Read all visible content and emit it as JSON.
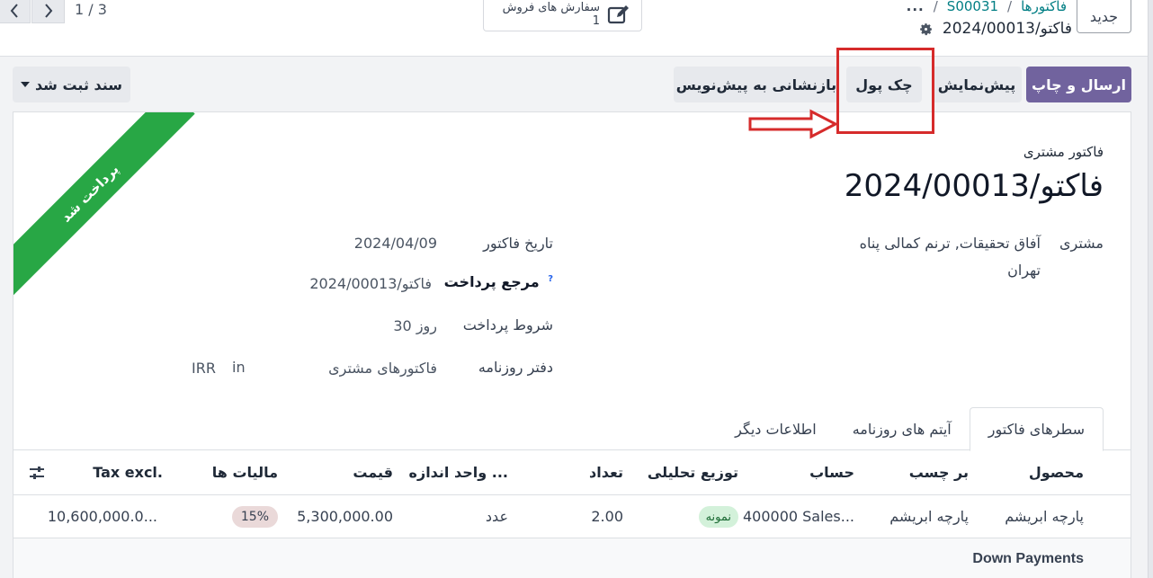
{
  "control_panel": {
    "new_button": "جدید",
    "breadcrumb": {
      "more": "...",
      "sales_order": "S00031",
      "invoices": "فاکتورها",
      "separator": "/"
    },
    "record_name": "فاکتو/2024/00013",
    "smart_button": {
      "label": "سفارش های فروش",
      "count": "1"
    },
    "pager": {
      "value": "1 / 3"
    }
  },
  "actions": {
    "send_print": "ارسال و چاپ",
    "preview": "پیش‌نمایش",
    "check": "چک پول",
    "reset_to_draft": "بازنشانی به پیش‌نویس",
    "status": "سند ثبت شد"
  },
  "ribbon": "پرداخت شد",
  "invoice": {
    "type_label": "فاکتور مشتری",
    "name": "فاکتو/2024/00013",
    "customer_label": "مشتری",
    "customer_name": "آفاق تحقیقات, ترنم کمالی پناه",
    "customer_city": "تهران",
    "date_label": "تاریخ فاکتور",
    "date_value": "2024/04/09",
    "payment_ref_label": "مرجع پرداخت",
    "payment_ref_help": "?",
    "payment_ref_value": "فاکتو/2024/00013",
    "payment_terms_label": "شروط پرداخت",
    "payment_terms_value": "30 روز",
    "journal_label": "دفتر روزنامه",
    "journal_value": "فاکتورهای مشتری",
    "journal_in": "in",
    "currency": "IRR"
  },
  "tabs": [
    "سطرهای فاکتور",
    "آیتم های روزنامه",
    "اطلاعات دیگر"
  ],
  "table": {
    "headers": {
      "product": "محصول",
      "label": "بر چسب",
      "account": "حساب",
      "analytic": "توزیع تحلیلی",
      "quantity": "تعداد",
      "uom": "واحد اندازه ...",
      "price": "قیمت",
      "taxes": "مالیات ها",
      "subtotal": "Tax excl."
    },
    "rows": [
      {
        "product": "پارچه ابریشم",
        "label": "پارچه ابریشم",
        "account": "400000 Sales...",
        "analytic": "نمونه",
        "quantity": "2.00",
        "uom": "عدد",
        "price": "5,300,000.00",
        "taxes": "15%",
        "subtotal": "10,600,000.0..."
      }
    ],
    "section": "Down Payments"
  },
  "colors": {
    "primary": "#71639e",
    "link": "#017e84",
    "ribbon": "#28a745",
    "annotation": "#d62b2b"
  }
}
